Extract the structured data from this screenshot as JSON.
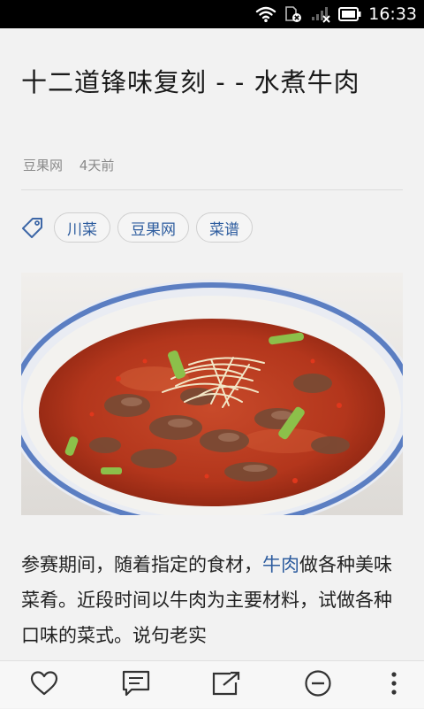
{
  "status_bar": {
    "time": "16:33",
    "icons": [
      "wifi-icon",
      "sim-blocked-icon",
      "signal-no-service-icon",
      "battery-icon"
    ]
  },
  "article": {
    "title": "十二道锋味复刻 - - 水煮牛肉",
    "source": "豆果网",
    "time_ago": "4天前",
    "tags": [
      "川菜",
      "豆果网",
      "菜谱"
    ],
    "image_alt": "水煮牛肉",
    "body": {
      "part1": "参赛期间，随着指定的食材，",
      "link": "牛肉",
      "part2": "做各种美味菜肴。近段时间以牛肉为主要材料，试做各种口味的菜式。说句老实"
    }
  },
  "bottom_bar": {
    "actions": [
      "like-icon",
      "comment-icon",
      "share-icon",
      "dislike-icon",
      "more-icon"
    ]
  },
  "colors": {
    "background": "#f2f2f2",
    "link": "#2e5d9f",
    "status_bar": "#000000",
    "soup": "#b5381e"
  }
}
